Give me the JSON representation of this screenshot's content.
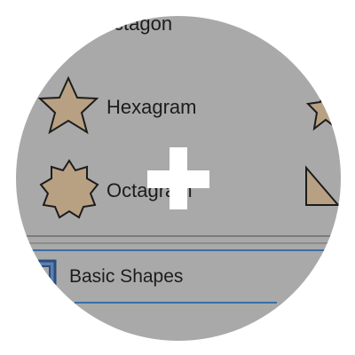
{
  "shapes_panel": {
    "partial_top_label": "ctagon",
    "items": [
      {
        "label": "Hexagram",
        "icon": "six-point-star-icon"
      },
      {
        "label": "Octagram",
        "icon": "eight-point-star-icon"
      }
    ],
    "right_partial_icons": [
      "star-icon",
      "right-triangle-icon"
    ]
  },
  "section": {
    "label": "Basic Shapes",
    "icon": "basic-shapes-icon"
  },
  "cursor": {
    "type": "crosshair-icon"
  },
  "colors": {
    "lens_bg": "#a9a9a9",
    "shape_fill": "#b8a183",
    "shape_stroke": "#1c1c1c",
    "accent_line": "#3a6ea5",
    "divider": "#777777",
    "cursor": "#ffffff"
  }
}
